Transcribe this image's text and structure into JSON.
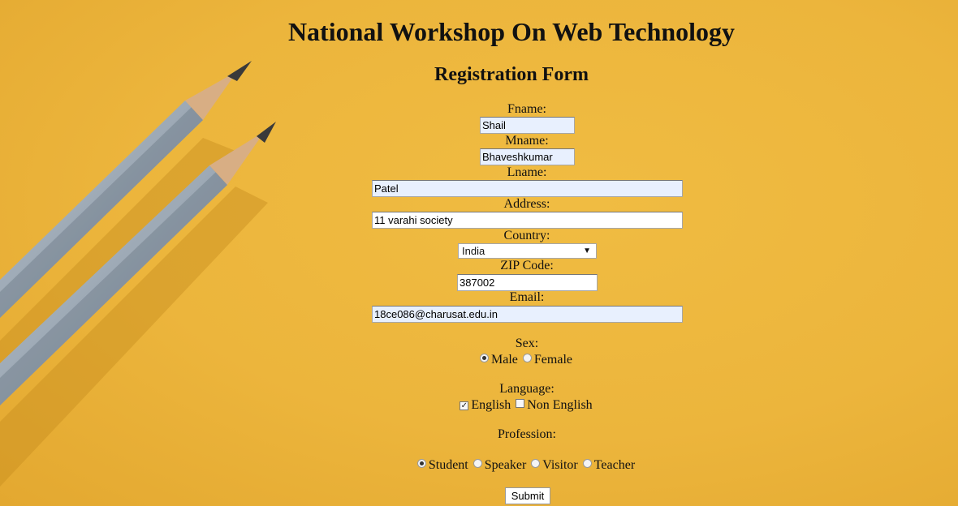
{
  "header": {
    "title": "National Workshop On Web Technology",
    "subtitle": "Registration Form"
  },
  "form": {
    "fname": {
      "label": "Fname:",
      "value": "Shail"
    },
    "mname": {
      "label": "Mname:",
      "value": "Bhaveshkumar"
    },
    "lname": {
      "label": "Lname:",
      "value": "Patel"
    },
    "address": {
      "label": "Address:",
      "value": "11 varahi society"
    },
    "country": {
      "label": "Country:",
      "selected": "India"
    },
    "zip": {
      "label": "ZIP Code:",
      "value": "387002"
    },
    "email": {
      "label": "Email:",
      "value": "18ce086@charusat.edu.in"
    },
    "sex": {
      "label": "Sex:",
      "options": [
        "Male",
        "Female"
      ],
      "selected": "Male"
    },
    "language": {
      "label": "Language:",
      "options": [
        "English",
        "Non English"
      ],
      "checked": [
        "English"
      ]
    },
    "profession": {
      "label": "Profession:",
      "options": [
        "Student",
        "Speaker",
        "Visitor",
        "Teacher"
      ],
      "selected": "Student"
    },
    "submit_label": "Submit"
  },
  "icons": {
    "background": "pencils-icon",
    "select_arrow": "chevron-down-icon"
  },
  "colors": {
    "background": "#ecb53c",
    "autofill": "#e8f0fe"
  }
}
